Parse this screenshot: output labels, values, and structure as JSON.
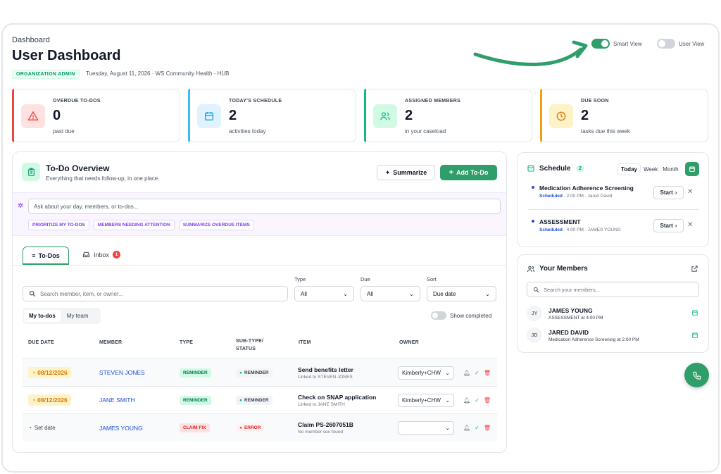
{
  "header": {
    "breadcrumb": "Dashboard",
    "title": "User Dashboard",
    "role": "ORGANIZATION ADMIN",
    "subline": "Tuesday, August 11, 2026 · WS Community Health - HUB",
    "smart_view": "Smart View",
    "user_view": "User View"
  },
  "stats": [
    {
      "label": "OVERDUE TO-DOS",
      "value": "0",
      "sub": "past due",
      "color": "#ef4444",
      "icon": "warning-icon"
    },
    {
      "label": "TODAY'S SCHEDULE",
      "value": "2",
      "sub": "activities today",
      "color": "#38bdf8",
      "icon": "calendar-icon"
    },
    {
      "label": "ASSIGNED MEMBERS",
      "value": "2",
      "sub": "in your caseload",
      "color": "#10b981",
      "icon": "users-icon"
    },
    {
      "label": "DUE SOON",
      "value": "2",
      "sub": "tasks due this week",
      "color": "#f59e0b",
      "icon": "clock-icon"
    }
  ],
  "todo": {
    "title": "To-Do Overview",
    "subtitle": "Everything that needs follow-up, in one place.",
    "summarize": "Summarize",
    "add": "Add To-Do",
    "ask_placeholder": "Ask about your day, members, or to-dos...",
    "chips": [
      "PRIORITIZE MY TO-DOS",
      "MEMBERS NEEDING ATTENTION",
      "SUMMARIZE OVERDUE ITEMS"
    ],
    "tab_todos": "To-Dos",
    "tab_inbox": "Inbox",
    "inbox_count": "1",
    "search_placeholder": "Search member, item, or owner...",
    "type_label": "Type",
    "type_value": "All",
    "due_label": "Due",
    "due_value": "All",
    "sort_label": "Sort",
    "sort_value": "Due date",
    "seg_mine": "My to-dos",
    "seg_team": "My team",
    "show_completed": "Show completed",
    "columns": [
      "DUE DATE",
      "MEMBER",
      "TYPE",
      "SUB-TYPE/",
      "STATUS",
      "ITEM",
      "OWNER"
    ],
    "rows": [
      {
        "due": "08/12/2026",
        "member": "STEVEN JONES",
        "type": "REMINDER",
        "status": "REMINDER",
        "item": "Send benefits letter",
        "item_sub": "Linked to STEVEN JONES",
        "owner": "Kimberly+CHW"
      },
      {
        "due": "08/12/2026",
        "member": "JANE SMITH",
        "type": "REMINDER",
        "status": "REMINDER",
        "item": "Check on SNAP application",
        "item_sub": "Linked to JANE SMITH",
        "owner": "Kimberly+CHW"
      },
      {
        "due": "Set date",
        "member": "JAMES YOUNG",
        "type": "CLAIM FIX",
        "status": "ERROR",
        "item": "Claim PS-2607051B",
        "item_sub": "No member sex found",
        "owner": ""
      }
    ]
  },
  "schedule": {
    "title": "Schedule",
    "count": "2",
    "today": "Today",
    "week": "Week",
    "month": "Month",
    "items": [
      {
        "title": "Medication Adherence Screening",
        "status": "Scheduled",
        "meta": " · 2:00 PM · Jared David",
        "start": "Start"
      },
      {
        "title": "ASSESSMENT",
        "status": "Scheduled",
        "meta": " · 4:00 PM · JAMES YOUNG",
        "start": "Start"
      }
    ]
  },
  "members": {
    "title": "Your Members",
    "search_placeholder": "Search your members...",
    "list": [
      {
        "initials": "JY",
        "name": "JAMES YOUNG",
        "detail": "ASSESSMENT at 4:00 PM"
      },
      {
        "initials": "JD",
        "name": "JARED DAVID",
        "detail": "Medication Adherence Screening at 2:00 PM"
      }
    ]
  }
}
